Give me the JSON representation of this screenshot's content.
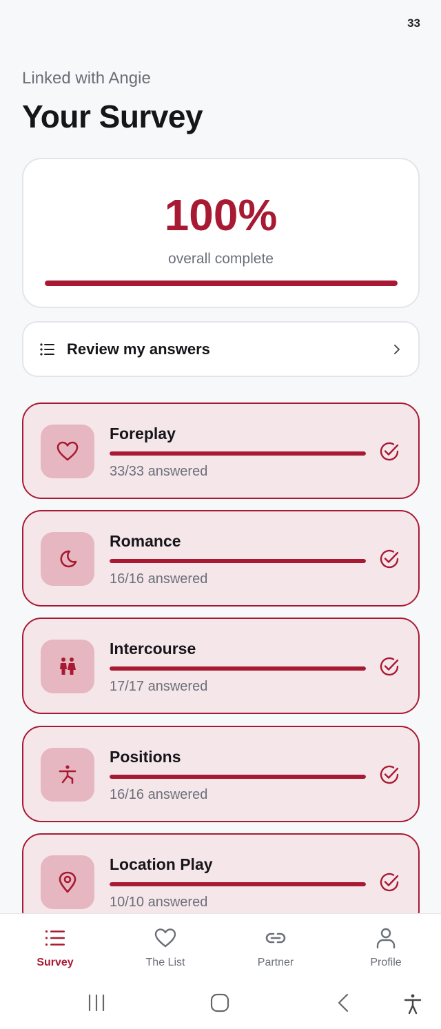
{
  "status_bar": {
    "battery": "33"
  },
  "header": {
    "subtitle": "Linked with Angie",
    "title": "Your Survey"
  },
  "overall": {
    "percent_text": "100%",
    "label": "overall complete",
    "progress": 1.0
  },
  "review": {
    "label": "Review my answers"
  },
  "categories": [
    {
      "name": "Foreplay",
      "count": "33/33 answered",
      "icon": "heart-icon",
      "progress": 1.0
    },
    {
      "name": "Romance",
      "count": "16/16 answered",
      "icon": "moon-icon",
      "progress": 1.0
    },
    {
      "name": "Intercourse",
      "count": "17/17 answered",
      "icon": "couple-icon",
      "progress": 1.0
    },
    {
      "name": "Positions",
      "count": "16/16 answered",
      "icon": "pose-icon",
      "progress": 1.0
    },
    {
      "name": "Location Play",
      "count": "10/10 answered",
      "icon": "location-pin-icon",
      "progress": 1.0
    }
  ],
  "nav": [
    {
      "label": "Survey",
      "icon": "list-icon",
      "active": true
    },
    {
      "label": "The List",
      "icon": "heart-icon",
      "active": false
    },
    {
      "label": "Partner",
      "icon": "link-icon",
      "active": false
    },
    {
      "label": "Profile",
      "icon": "person-icon",
      "active": false
    }
  ],
  "colors": {
    "accent": "#a81a33",
    "card_bg": "#f5e6ea",
    "icon_bg": "#e6b7c0",
    "muted_text": "#6b6f78"
  }
}
